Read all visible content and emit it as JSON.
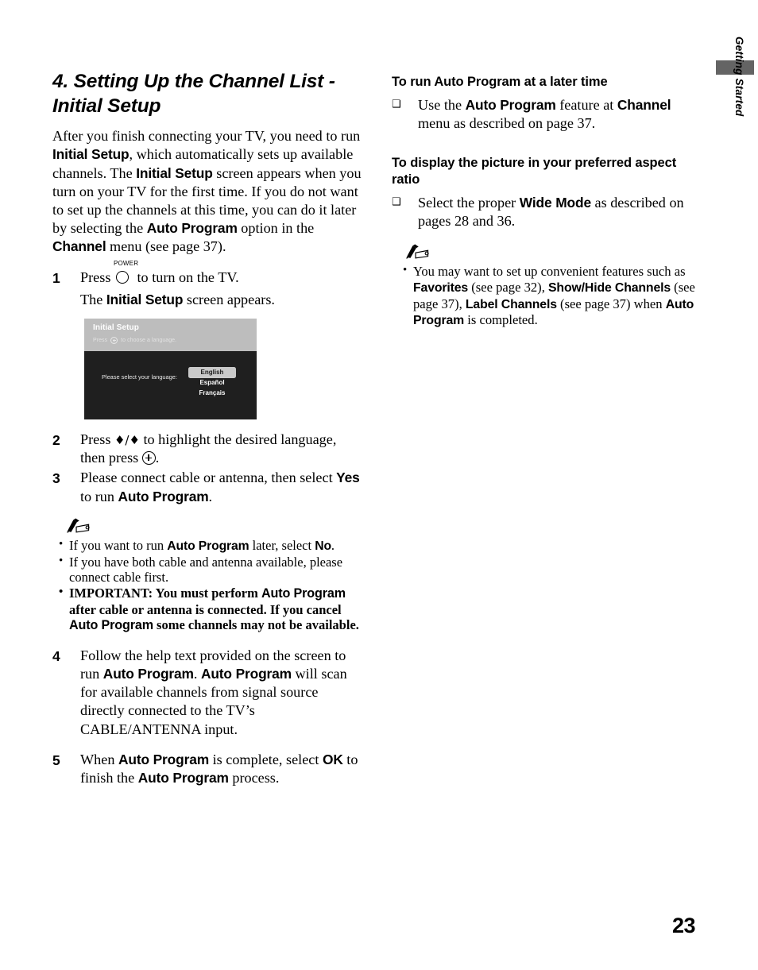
{
  "side_tab": {
    "label": "Getting Started",
    "block_color": "#646464"
  },
  "left_column": {
    "chapter_title": "4. Setting Up the Channel List - Initial Setup",
    "intro_segments": [
      {
        "text": "After you finish connecting your TV, you need to run ",
        "style": "plain"
      },
      {
        "text": "Initial Setup",
        "style": "sans-bold"
      },
      {
        "text": ", which automatically sets up available channels. The ",
        "style": "plain"
      },
      {
        "text": "Initial Setup",
        "style": "sans-bold"
      },
      {
        "text": " screen appears when you turn on your TV for the first time. If you do not want to set up the channels at this time, you can do it later by selecting the ",
        "style": "plain"
      },
      {
        "text": "Auto Program",
        "style": "sans-bold"
      },
      {
        "text": " option in the ",
        "style": "plain"
      },
      {
        "text": "Channel",
        "style": "sans-bold"
      },
      {
        "text": " menu (see page 37).",
        "style": "plain"
      }
    ],
    "steps": [
      {
        "number": "1",
        "lead": "Press",
        "power_label": "POWER",
        "trail": "to turn on the TV.",
        "sub_pre": "The ",
        "sub_bold": "Initial Setup",
        "sub_post": " screen appears."
      },
      {
        "number": "2",
        "lead": "Press",
        "arrows": "♦/♦",
        "mid": "to highlight the desired language, then press",
        "trail": "."
      },
      {
        "number": "3",
        "pre": "Please connect cable or antenna, then select ",
        "bold1": "Yes",
        "mid": " to run ",
        "bold2": "Auto Program",
        "post": "."
      },
      {
        "number": "4",
        "pre": "Follow the help text provided on the screen to run ",
        "bold1": "Auto Program",
        "mid": ". ",
        "bold2": "Auto Program",
        "post": " will scan for available channels from signal source directly connected to the TV’s CABLE/ANTENNA input."
      },
      {
        "number": "5",
        "pre": "When ",
        "bold1": "Auto Program",
        "mid": " is complete, select ",
        "bold2": "OK",
        "post2": " to finish the ",
        "bold3": "Auto Program",
        "post": " process."
      }
    ],
    "tv_screen": {
      "header_title": "Initial Setup",
      "header_sub_pre": "Press",
      "header_sub_post": "to choose a language.",
      "prompt": "Please select your language:",
      "options": [
        {
          "label": "English",
          "selected": true
        },
        {
          "label": "Español",
          "selected": false
        },
        {
          "label": "Français",
          "selected": false
        }
      ]
    },
    "notes": [
      {
        "segments": [
          {
            "text": "If you want to run ",
            "style": "plain"
          },
          {
            "text": "Auto Program",
            "style": "sans-bold"
          },
          {
            "text": " later, select ",
            "style": "plain"
          },
          {
            "text": "No",
            "style": "sans-bold"
          },
          {
            "text": ".",
            "style": "plain"
          }
        ],
        "important": false
      },
      {
        "segments": [
          {
            "text": "If you have both cable and antenna available, please connect cable first.",
            "style": "plain"
          }
        ],
        "important": false
      },
      {
        "segments": [
          {
            "text": "IMPORTANT: You must perform ",
            "style": "plain"
          },
          {
            "text": "Auto Program",
            "style": "sans-bold"
          },
          {
            "text": " after cable or antenna is connected. If you cancel ",
            "style": "plain"
          },
          {
            "text": "Auto Program",
            "style": "sans-bold"
          },
          {
            "text": " some channels may not be available.",
            "style": "plain"
          }
        ],
        "important": true
      }
    ]
  },
  "right_column": {
    "section1": {
      "heading": "To run Auto Program at a later time",
      "checkbox_glyph": "❑",
      "segments": [
        {
          "text": "Use the ",
          "style": "plain"
        },
        {
          "text": "Auto Program",
          "style": "sans-bold"
        },
        {
          "text": " feature at ",
          "style": "plain"
        },
        {
          "text": "Channel",
          "style": "sans-bold"
        },
        {
          "text": " menu as described on page 37.",
          "style": "plain"
        }
      ]
    },
    "section2": {
      "heading": "To display the picture in your preferred aspect ratio",
      "checkbox_glyph": "❑",
      "segments": [
        {
          "text": "Select the proper ",
          "style": "plain"
        },
        {
          "text": "Wide Mode",
          "style": "sans-bold"
        },
        {
          "text": " as described on pages 28 and 36.",
          "style": "plain"
        }
      ]
    },
    "notes": [
      {
        "segments": [
          {
            "text": "You may want to set up convenient features such as ",
            "style": "plain"
          },
          {
            "text": "Favorites",
            "style": "sans-bold"
          },
          {
            "text": " (see page 32), ",
            "style": "plain"
          },
          {
            "text": "Show/Hide Channels",
            "style": "sans-bold"
          },
          {
            "text": " (see page 37), ",
            "style": "plain"
          },
          {
            "text": "Label Channels",
            "style": "sans-bold"
          },
          {
            "text": " (see page 37) when ",
            "style": "plain"
          },
          {
            "text": "Auto Program",
            "style": "sans-bold"
          },
          {
            "text": " is completed.",
            "style": "plain"
          }
        ],
        "important": false
      }
    ]
  },
  "folio": {
    "page_number": "23"
  },
  "icons": {
    "note_pencil": "note-pencil-icon",
    "power_button": "power-button-icon",
    "enter_button": "enter-button-icon",
    "up_down_arrows": "up-down-arrows-icon"
  }
}
